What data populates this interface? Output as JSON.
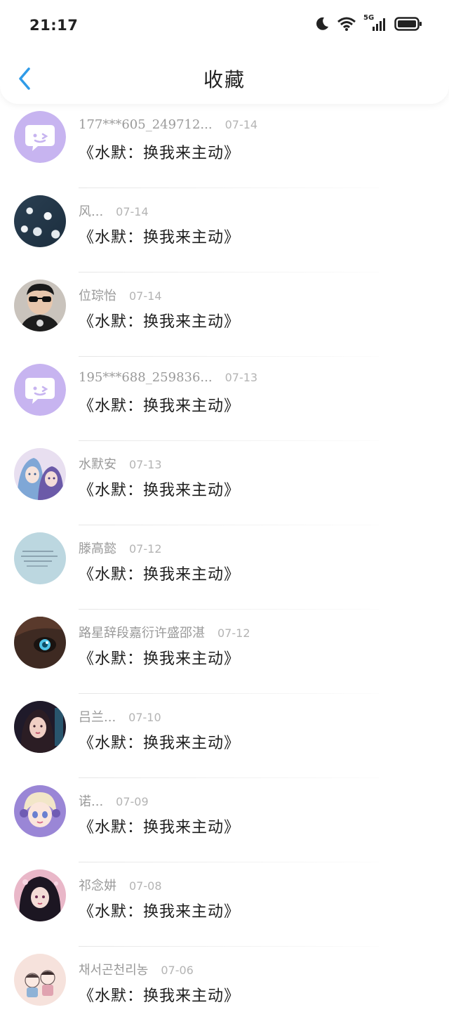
{
  "status_bar": {
    "time": "21:17",
    "network": "5G"
  },
  "header": {
    "title": "收藏",
    "back_icon": "chevron-left-icon",
    "accent": "#2f9be8"
  },
  "items": [
    {
      "username": "177***605_249712...",
      "date": "07-14",
      "title": "《水默：换我来主动》",
      "avatar": "chat-bubble"
    },
    {
      "username": "风...",
      "date": "07-14",
      "title": "《水默：换我来主动》",
      "avatar": "frost"
    },
    {
      "username": "位琮怡",
      "date": "07-14",
      "title": "《水默：换我来主动》",
      "avatar": "man-sunglasses"
    },
    {
      "username": "195***688_259836...",
      "date": "07-13",
      "title": "《水默：换我来主动》",
      "avatar": "chat-bubble"
    },
    {
      "username": "水默安",
      "date": "07-13",
      "title": "《水默：换我来主动》",
      "avatar": "anime-pair"
    },
    {
      "username": "滕高懿",
      "date": "07-12",
      "title": "《水默：换我来主动》",
      "avatar": "text-note"
    },
    {
      "username": "路星辞段嘉衍许盛邵湛",
      "date": "07-12",
      "title": "《水默：换我来主动》",
      "avatar": "blue-eye"
    },
    {
      "username": "吕兰...",
      "date": "07-10",
      "title": "《水默：换我来主动》",
      "avatar": "girl-neon"
    },
    {
      "username": "诺...",
      "date": "07-09",
      "title": "《水默：换我来主动》",
      "avatar": "doll-purple"
    },
    {
      "username": "祁念妌",
      "date": "07-08",
      "title": "《水默：换我来主动》",
      "avatar": "dark-girl"
    },
    {
      "username": "채서곤천리농",
      "date": "07-06",
      "title": "《水默：换我来主动》",
      "avatar": "cartoon-kids"
    }
  ]
}
